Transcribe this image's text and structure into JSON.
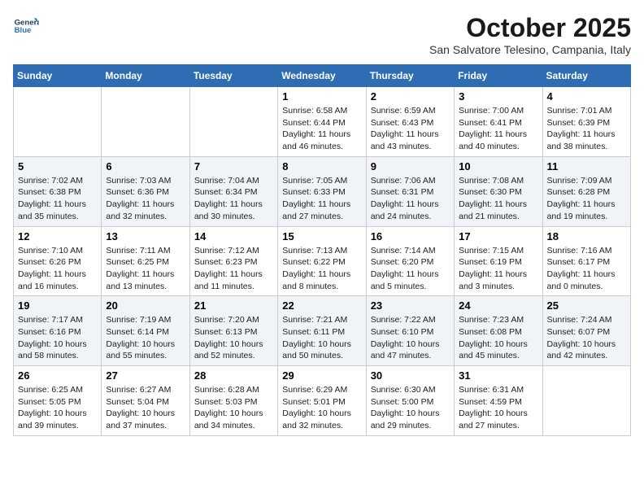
{
  "header": {
    "logo_line1": "General",
    "logo_line2": "Blue",
    "month": "October 2025",
    "location": "San Salvatore Telesino, Campania, Italy"
  },
  "days_of_week": [
    "Sunday",
    "Monday",
    "Tuesday",
    "Wednesday",
    "Thursday",
    "Friday",
    "Saturday"
  ],
  "weeks": [
    [
      {
        "day": "",
        "info": ""
      },
      {
        "day": "",
        "info": ""
      },
      {
        "day": "",
        "info": ""
      },
      {
        "day": "1",
        "info": "Sunrise: 6:58 AM\nSunset: 6:44 PM\nDaylight: 11 hours\nand 46 minutes."
      },
      {
        "day": "2",
        "info": "Sunrise: 6:59 AM\nSunset: 6:43 PM\nDaylight: 11 hours\nand 43 minutes."
      },
      {
        "day": "3",
        "info": "Sunrise: 7:00 AM\nSunset: 6:41 PM\nDaylight: 11 hours\nand 40 minutes."
      },
      {
        "day": "4",
        "info": "Sunrise: 7:01 AM\nSunset: 6:39 PM\nDaylight: 11 hours\nand 38 minutes."
      }
    ],
    [
      {
        "day": "5",
        "info": "Sunrise: 7:02 AM\nSunset: 6:38 PM\nDaylight: 11 hours\nand 35 minutes."
      },
      {
        "day": "6",
        "info": "Sunrise: 7:03 AM\nSunset: 6:36 PM\nDaylight: 11 hours\nand 32 minutes."
      },
      {
        "day": "7",
        "info": "Sunrise: 7:04 AM\nSunset: 6:34 PM\nDaylight: 11 hours\nand 30 minutes."
      },
      {
        "day": "8",
        "info": "Sunrise: 7:05 AM\nSunset: 6:33 PM\nDaylight: 11 hours\nand 27 minutes."
      },
      {
        "day": "9",
        "info": "Sunrise: 7:06 AM\nSunset: 6:31 PM\nDaylight: 11 hours\nand 24 minutes."
      },
      {
        "day": "10",
        "info": "Sunrise: 7:08 AM\nSunset: 6:30 PM\nDaylight: 11 hours\nand 21 minutes."
      },
      {
        "day": "11",
        "info": "Sunrise: 7:09 AM\nSunset: 6:28 PM\nDaylight: 11 hours\nand 19 minutes."
      }
    ],
    [
      {
        "day": "12",
        "info": "Sunrise: 7:10 AM\nSunset: 6:26 PM\nDaylight: 11 hours\nand 16 minutes."
      },
      {
        "day": "13",
        "info": "Sunrise: 7:11 AM\nSunset: 6:25 PM\nDaylight: 11 hours\nand 13 minutes."
      },
      {
        "day": "14",
        "info": "Sunrise: 7:12 AM\nSunset: 6:23 PM\nDaylight: 11 hours\nand 11 minutes."
      },
      {
        "day": "15",
        "info": "Sunrise: 7:13 AM\nSunset: 6:22 PM\nDaylight: 11 hours\nand 8 minutes."
      },
      {
        "day": "16",
        "info": "Sunrise: 7:14 AM\nSunset: 6:20 PM\nDaylight: 11 hours\nand 5 minutes."
      },
      {
        "day": "17",
        "info": "Sunrise: 7:15 AM\nSunset: 6:19 PM\nDaylight: 11 hours\nand 3 minutes."
      },
      {
        "day": "18",
        "info": "Sunrise: 7:16 AM\nSunset: 6:17 PM\nDaylight: 11 hours\nand 0 minutes."
      }
    ],
    [
      {
        "day": "19",
        "info": "Sunrise: 7:17 AM\nSunset: 6:16 PM\nDaylight: 10 hours\nand 58 minutes."
      },
      {
        "day": "20",
        "info": "Sunrise: 7:19 AM\nSunset: 6:14 PM\nDaylight: 10 hours\nand 55 minutes."
      },
      {
        "day": "21",
        "info": "Sunrise: 7:20 AM\nSunset: 6:13 PM\nDaylight: 10 hours\nand 52 minutes."
      },
      {
        "day": "22",
        "info": "Sunrise: 7:21 AM\nSunset: 6:11 PM\nDaylight: 10 hours\nand 50 minutes."
      },
      {
        "day": "23",
        "info": "Sunrise: 7:22 AM\nSunset: 6:10 PM\nDaylight: 10 hours\nand 47 minutes."
      },
      {
        "day": "24",
        "info": "Sunrise: 7:23 AM\nSunset: 6:08 PM\nDaylight: 10 hours\nand 45 minutes."
      },
      {
        "day": "25",
        "info": "Sunrise: 7:24 AM\nSunset: 6:07 PM\nDaylight: 10 hours\nand 42 minutes."
      }
    ],
    [
      {
        "day": "26",
        "info": "Sunrise: 6:25 AM\nSunset: 5:05 PM\nDaylight: 10 hours\nand 39 minutes."
      },
      {
        "day": "27",
        "info": "Sunrise: 6:27 AM\nSunset: 5:04 PM\nDaylight: 10 hours\nand 37 minutes."
      },
      {
        "day": "28",
        "info": "Sunrise: 6:28 AM\nSunset: 5:03 PM\nDaylight: 10 hours\nand 34 minutes."
      },
      {
        "day": "29",
        "info": "Sunrise: 6:29 AM\nSunset: 5:01 PM\nDaylight: 10 hours\nand 32 minutes."
      },
      {
        "day": "30",
        "info": "Sunrise: 6:30 AM\nSunset: 5:00 PM\nDaylight: 10 hours\nand 29 minutes."
      },
      {
        "day": "31",
        "info": "Sunrise: 6:31 AM\nSunset: 4:59 PM\nDaylight: 10 hours\nand 27 minutes."
      },
      {
        "day": "",
        "info": ""
      }
    ]
  ]
}
